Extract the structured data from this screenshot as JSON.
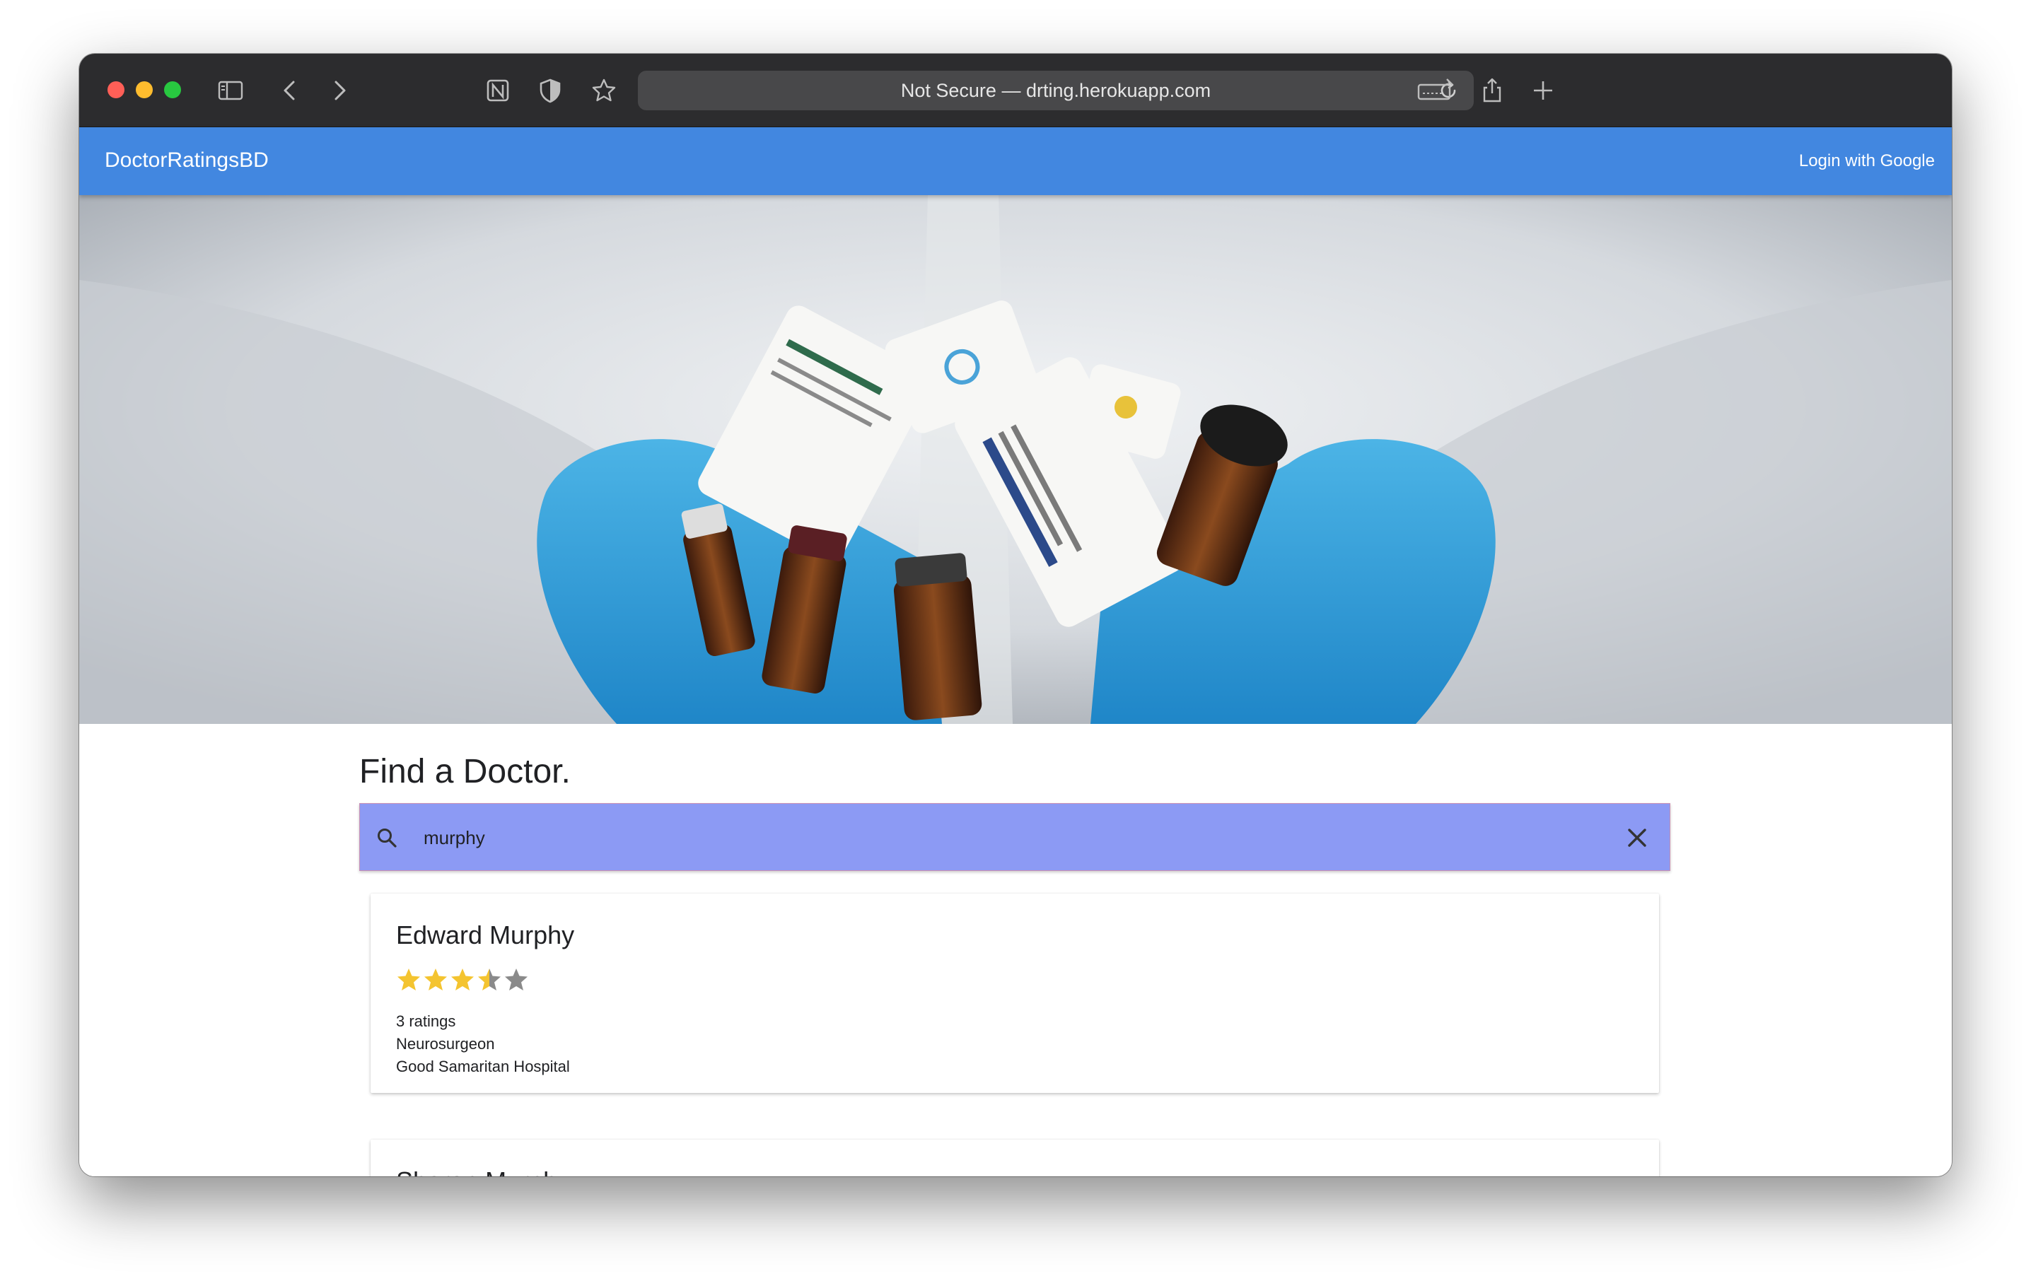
{
  "browser": {
    "address": "Not Secure — drting.herokuapp.com",
    "toolbar_icons": [
      "sidebar-icon",
      "back-icon",
      "forward-icon",
      "notion-icon",
      "shield-icon",
      "star-icon",
      "reload-icon",
      "keyboard-icon",
      "share-icon",
      "new-tab-icon"
    ]
  },
  "nav": {
    "brand": "DoctorRatingsBD",
    "login": "Login with Google",
    "color": "#4287e0"
  },
  "hero": {
    "image": "gloved hands holding medicine vials"
  },
  "search": {
    "title": "Find a Doctor.",
    "value": "murphy",
    "bar_color": "#8c9af4",
    "icons": [
      "search-icon",
      "clear-icon"
    ]
  },
  "results": [
    {
      "name": "Edward Murphy",
      "rating": 3.5,
      "max_rating": 5,
      "ratings_count": "3 ratings",
      "specialty": "Neurosurgeon",
      "hospital": "Good Samaritan Hospital"
    },
    {
      "name": "Sharon Murphy"
    }
  ]
}
